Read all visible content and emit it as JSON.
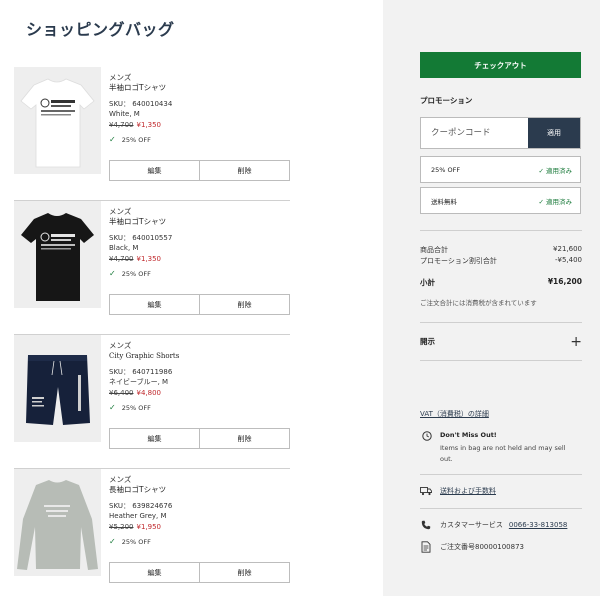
{
  "page": {
    "title": "ショッピングバッグ"
  },
  "items": [
    {
      "category": "メンズ",
      "name": "半袖ロゴTシャツ",
      "sku": "SKU： 640010434",
      "color": "White, M",
      "old_price": "¥4,700",
      "new_price": "¥1,350",
      "discount": "25% OFF",
      "edit": "編集",
      "remove": "削除",
      "shirt_text": "ABERCROMBIE & FITCH"
    },
    {
      "category": "メンズ",
      "name": "半袖ロゴTシャツ",
      "sku": "SKU： 640010557",
      "color": "Black, M",
      "old_price": "¥4,700",
      "new_price": "¥1,350",
      "discount": "25% OFF",
      "edit": "編集",
      "remove": "削除",
      "shirt_text": "ABERCROMBIE & FITCH"
    },
    {
      "category": "メンズ",
      "name": "City Graphic Shorts",
      "sku": "SKU： 640711986",
      "color": "ネイビーブルー, M",
      "old_price": "¥6,400",
      "new_price": "¥4,800",
      "discount": "25% OFF",
      "edit": "編集",
      "remove": "削除",
      "shirt_text": ""
    },
    {
      "category": "メンズ",
      "name": "長袖ロゴTシャツ",
      "sku": "SKU： 639824676",
      "color": "Heather Grey, M",
      "old_price": "¥5,200",
      "new_price": "¥1,950",
      "discount": "25% OFF",
      "edit": "編集",
      "remove": "削除",
      "shirt_text": ""
    }
  ],
  "checkout": {
    "label": "チェックアウト"
  },
  "promotion": {
    "title": "プロモーション",
    "coupon_placeholder": "クーポンコード",
    "apply_label": "適用",
    "applied": [
      {
        "label": "25% OFF",
        "status": "適用済み"
      },
      {
        "label": "送料無料",
        "status": "適用済み"
      }
    ]
  },
  "summary": {
    "merch_label": "商品合計",
    "merch_value": "¥21,600",
    "promo_label": "プロモーション割引合計",
    "promo_value": "-¥5,400",
    "subtotal_label": "小計",
    "subtotal_value": "¥16,200",
    "tax_note": "ご注文合計には消費税が含まれています"
  },
  "disclosure": {
    "label": "開示"
  },
  "info": {
    "vat_link": "VAT（消費税）の詳細",
    "dont_miss_title": "Don't Miss Out!",
    "dont_miss_body": "Items in bag are not held and may sell out.",
    "shipping_link": "送料および手数料",
    "cs_label": "カスタマーサービス",
    "cs_phone": "0066-33-813058",
    "order_number": "ご注文番号80000100873"
  },
  "colors": {
    "accent_green": "#137a35",
    "navy": "#2b3b4e",
    "sale_red": "#c0282c"
  },
  "icons": [
    "check-icon",
    "plus-icon",
    "clock-icon",
    "truck-icon",
    "phone-icon",
    "document-icon"
  ]
}
